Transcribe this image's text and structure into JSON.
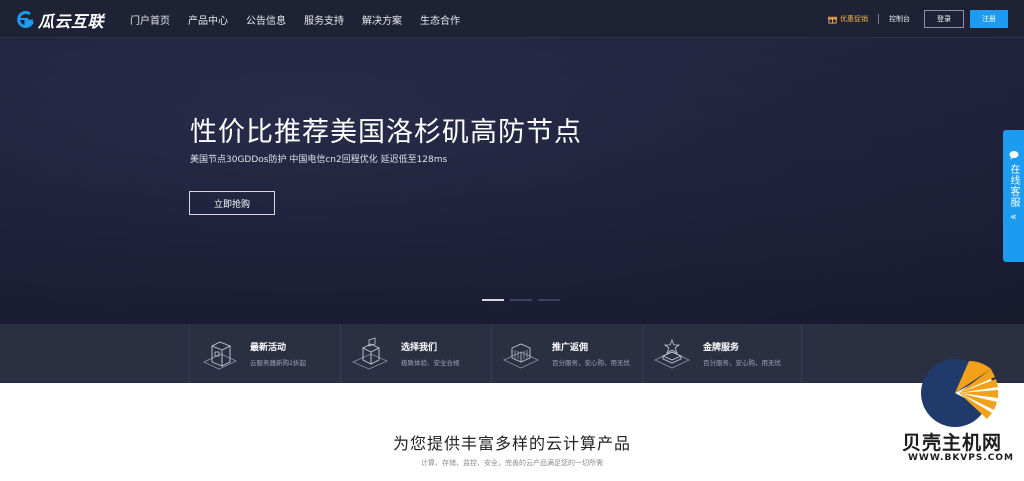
{
  "nav": {
    "logo_text": "瓜云互联",
    "menu": [
      "门户首页",
      "产品中心",
      "公告信息",
      "服务支持",
      "解决方案",
      "生态合作"
    ],
    "promo_label": "优惠促销",
    "console_label": "控制台",
    "login_label": "登录",
    "register_label": "注册"
  },
  "hero": {
    "title": "性价比推荐美国洛杉矶高防节点",
    "subtitle": "美国节点30GDDos防护 中国电信cn2回程优化 延迟低至128ms",
    "cta_label": "立即抢购",
    "slide_count": 3,
    "active_slide": 1
  },
  "side_service": {
    "label": "在线客服",
    "arrow": "«"
  },
  "features": [
    {
      "title": "最新活动",
      "desc": "云服务器新购2折起",
      "icon": "server-box-icon"
    },
    {
      "title": "选择我们",
      "desc": "极致体验、安全合规",
      "icon": "cube-stack-icon"
    },
    {
      "title": "推广返佣",
      "desc": "百分服务，安心购，用无忧",
      "icon": "building-icon"
    },
    {
      "title": "金牌服务",
      "desc": "百分服务，安心购，用无忧",
      "icon": "medal-platform-icon"
    }
  ],
  "section": {
    "title": "为您提供丰富多样的云计算产品",
    "subtitle": "计算、存储、监控、安全，完善的云产品满足您的一切所需"
  },
  "watermark": {
    "text": "贝壳主机网",
    "url": "WWW.BKVPS.COM"
  },
  "colors": {
    "accent": "#1b9cf0",
    "nav_bg": "#1f2235",
    "hero_bg": "#212440",
    "strip_bg": "#2b2f42",
    "promo": "#f3b24b"
  }
}
